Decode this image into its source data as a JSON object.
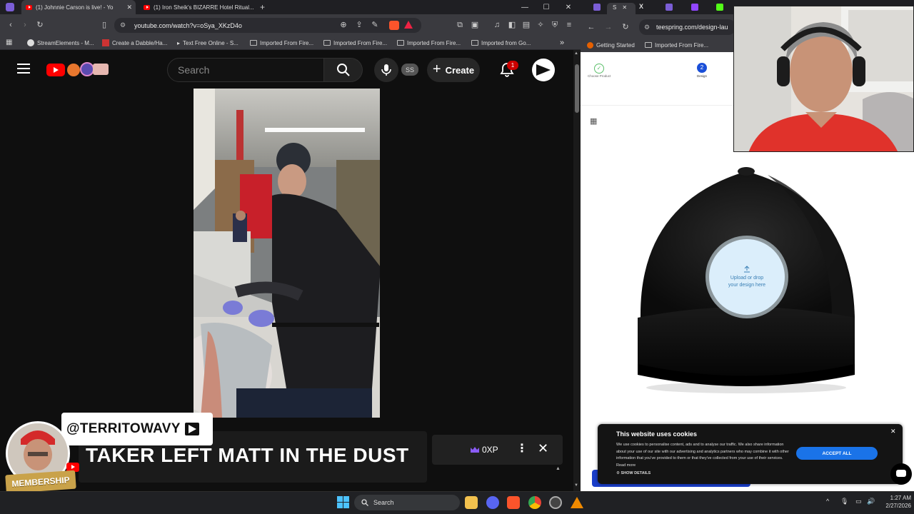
{
  "left_browser": {
    "tabs": [
      {
        "title": "(1) Johnnie Carson is live! - Yo",
        "active": true
      },
      {
        "title": "(1) Iron Sheik's BIZARRE Hotel Ritual...",
        "active": false
      }
    ],
    "new_tab_icon": "plus-icon",
    "url": "youtube.com/watch?v=oSya_XKzD4o",
    "bookmarks": [
      "StreamElements - M...",
      "Create a Dabble/Ha...",
      "Text Free Online - S...",
      "Imported From Fire...",
      "Imported From Fire...",
      "Imported From Fire...",
      "Imported from Go..."
    ]
  },
  "youtube": {
    "search_placeholder": "Search",
    "avatar_initials": "SS",
    "create_label": "Create",
    "notification_count": "1",
    "xp_label": "0XP"
  },
  "overlay": {
    "handle": "@TERRITOWAVY",
    "ticker": "TAKER LEFT MATT IN THE DUST",
    "membership": "MEMBERSHIP"
  },
  "right_browser": {
    "url": "teespring.com/design-lau",
    "bookmarks": [
      "Getting Started",
      "Imported From Fire..."
    ],
    "steps": [
      {
        "label": "Choose Product",
        "state": "done"
      },
      {
        "label": "Design",
        "number": "2",
        "state": "current"
      }
    ],
    "upload_text_line1": "Upload or drop",
    "upload_text_line2": "your design here",
    "cookie": {
      "title": "This website uses cookies",
      "body": "We use cookies to personalise content, ads and to analyse our traffic. We also share information about your use of our site with our advertising and analytics partners who may combine it with other information that you've provided to them or that they've collected from your use of their services. Read more",
      "accept_label": "ACCEPT ALL",
      "details_label": "SHOW DETAILS"
    }
  },
  "taskbar": {
    "search_label": "Search",
    "time": "1:27 AM",
    "date": "2/27/2026"
  },
  "colors": {
    "youtube_red": "#ff0000",
    "accept_blue": "#1a73e8",
    "membership_gold": "#c9a24a"
  }
}
